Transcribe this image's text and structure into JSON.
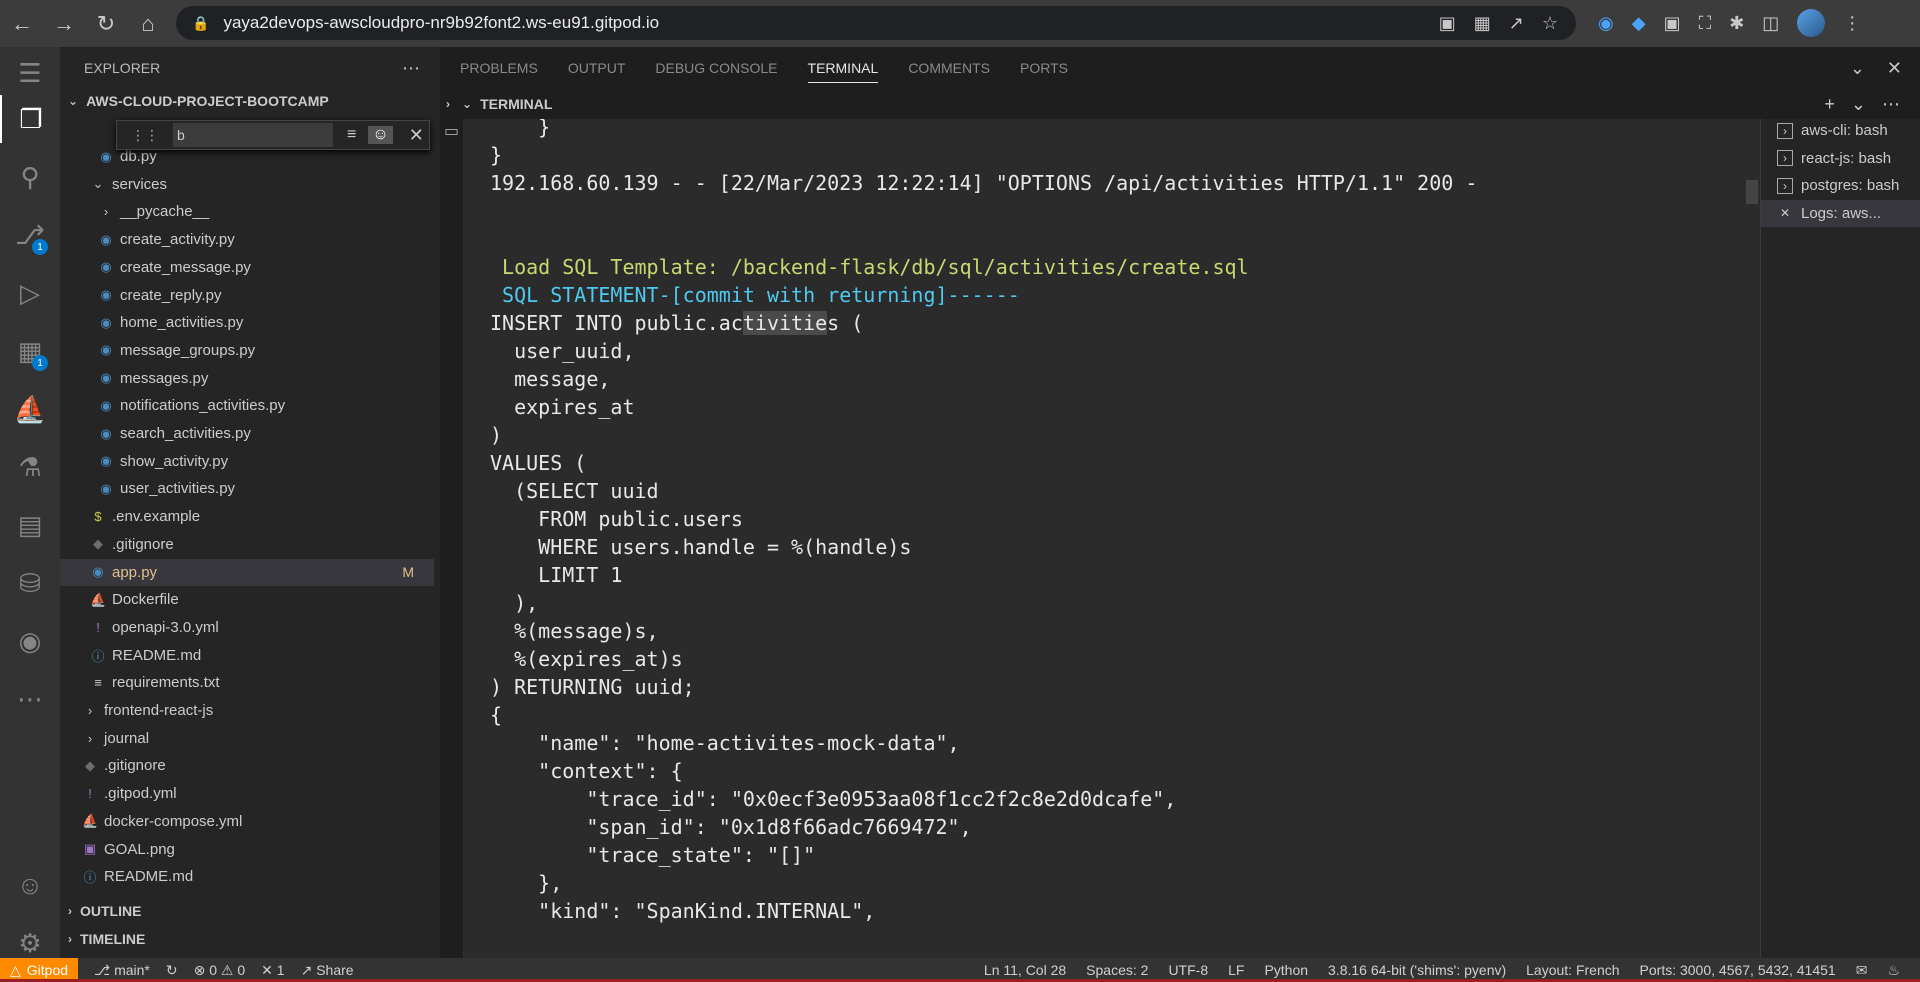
{
  "browser": {
    "url": "yaya2devops-awscloudpro-nr9b92font2.ws-eu91.gitpod.io"
  },
  "activity_bar": {
    "source_control_badge": "1",
    "extensions_badge": "1"
  },
  "sidebar": {
    "title": "EXPLORER",
    "project": "AWS-CLOUD-PROJECT-BOOTCAMP",
    "find_value": "b",
    "outline": "OUTLINE",
    "timeline": "TIMELINE",
    "tree": [
      {
        "label": "db.py",
        "icon": "python-icon",
        "indent": 2,
        "kind": "py"
      },
      {
        "label": "services",
        "icon": "chevron-down-icon",
        "indent": 1,
        "kind": "folder"
      },
      {
        "label": "__pycache__",
        "icon": "chevron-right-icon",
        "indent": 2,
        "kind": "folder"
      },
      {
        "label": "create_activity.py",
        "icon": "python-icon",
        "indent": 2,
        "kind": "py"
      },
      {
        "label": "create_message.py",
        "icon": "python-icon",
        "indent": 2,
        "kind": "py"
      },
      {
        "label": "create_reply.py",
        "icon": "python-icon",
        "indent": 2,
        "kind": "py"
      },
      {
        "label": "home_activities.py",
        "icon": "python-icon",
        "indent": 2,
        "kind": "py"
      },
      {
        "label": "message_groups.py",
        "icon": "python-icon",
        "indent": 2,
        "kind": "py"
      },
      {
        "label": "messages.py",
        "icon": "python-icon",
        "indent": 2,
        "kind": "py"
      },
      {
        "label": "notifications_activities.py",
        "icon": "python-icon",
        "indent": 2,
        "kind": "py"
      },
      {
        "label": "search_activities.py",
        "icon": "python-icon",
        "indent": 2,
        "kind": "py"
      },
      {
        "label": "show_activity.py",
        "icon": "python-icon",
        "indent": 2,
        "kind": "py"
      },
      {
        "label": "user_activities.py",
        "icon": "python-icon",
        "indent": 2,
        "kind": "py"
      },
      {
        "label": ".env.example",
        "icon": "dollar-icon",
        "indent": 1,
        "kind": "env"
      },
      {
        "label": ".gitignore",
        "icon": "git-icon",
        "indent": 1,
        "kind": "git"
      },
      {
        "label": "app.py",
        "icon": "python-icon",
        "indent": 1,
        "kind": "py",
        "selected": true,
        "modified": "M"
      },
      {
        "label": "Dockerfile",
        "icon": "docker-icon",
        "indent": 1,
        "kind": "docker"
      },
      {
        "label": "openapi-3.0.yml",
        "icon": "exclamation-icon",
        "indent": 1,
        "kind": "yml"
      },
      {
        "label": "README.md",
        "icon": "info-icon",
        "indent": 1,
        "kind": "md"
      },
      {
        "label": "requirements.txt",
        "icon": "lines-icon",
        "indent": 1,
        "kind": "txt"
      },
      {
        "label": "frontend-react-js",
        "icon": "chevron-right-icon",
        "indent": 0,
        "kind": "folder"
      },
      {
        "label": "journal",
        "icon": "chevron-right-icon",
        "indent": 0,
        "kind": "folder"
      },
      {
        "label": ".gitignore",
        "icon": "git-icon",
        "indent": 0,
        "kind": "git"
      },
      {
        "label": ".gitpod.yml",
        "icon": "exclamation-icon",
        "indent": 0,
        "kind": "yml"
      },
      {
        "label": "docker-compose.yml",
        "icon": "docker-icon",
        "indent": 0,
        "kind": "docker"
      },
      {
        "label": "GOAL.png",
        "icon": "image-icon",
        "indent": 0,
        "kind": "png"
      },
      {
        "label": "README.md",
        "icon": "info-icon",
        "indent": 0,
        "kind": "md"
      }
    ]
  },
  "panel": {
    "tabs": [
      "PROBLEMS",
      "OUTPUT",
      "DEBUG CONSOLE",
      "TERMINAL",
      "COMMENTS",
      "PORTS"
    ],
    "active_tab": "TERMINAL",
    "terminal_header": "TERMINAL"
  },
  "terminal": {
    "lines": [
      {
        "text": "    }",
        "style": ""
      },
      {
        "text": "}",
        "style": ""
      },
      {
        "text": "192.168.60.139 - - [22/Mar/2023 12:22:14] \"OPTIONS /api/activities HTTP/1.1\" 200 -",
        "style": ""
      },
      {
        "text": "",
        "style": ""
      },
      {
        "text": "",
        "style": ""
      },
      {
        "text": " Load SQL Template: /backend-flask/db/sql/activities/create.sql",
        "style": "green"
      },
      {
        "text": " SQL STATEMENT-[commit with returning]------",
        "style": "cyan"
      },
      {
        "text": "INSERT INTO public.activities (",
        "style": "hl"
      },
      {
        "text": "  user_uuid,",
        "style": ""
      },
      {
        "text": "  message,",
        "style": ""
      },
      {
        "text": "  expires_at",
        "style": ""
      },
      {
        "text": ")",
        "style": ""
      },
      {
        "text": "VALUES (",
        "style": ""
      },
      {
        "text": "  (SELECT uuid",
        "style": ""
      },
      {
        "text": "    FROM public.users",
        "style": ""
      },
      {
        "text": "    WHERE users.handle = %(handle)s",
        "style": ""
      },
      {
        "text": "    LIMIT 1",
        "style": ""
      },
      {
        "text": "  ),",
        "style": ""
      },
      {
        "text": "  %(message)s,",
        "style": ""
      },
      {
        "text": "  %(expires_at)s",
        "style": ""
      },
      {
        "text": ") RETURNING uuid;",
        "style": ""
      },
      {
        "text": "{",
        "style": ""
      },
      {
        "text": "    \"name\": \"home-activites-mock-data\",",
        "style": ""
      },
      {
        "text": "    \"context\": {",
        "style": ""
      },
      {
        "text": "        \"trace_id\": \"0x0ecf3e0953aa08f1cc2f2c8e2d0dcafe\",",
        "style": ""
      },
      {
        "text": "        \"span_id\": \"0x1d8f66adc7669472\",",
        "style": ""
      },
      {
        "text": "        \"trace_state\": \"[]\"",
        "style": ""
      },
      {
        "text": "    },",
        "style": ""
      },
      {
        "text": "    \"kind\": \"SpanKind.INTERNAL\",",
        "style": ""
      }
    ],
    "hl_prefix": "INSERT INTO public.ac",
    "hl_word": "tivitie",
    "hl_suffix": "s ("
  },
  "terminal_list": [
    {
      "label": "aws-cli: bash",
      "icon": "terminal-icon"
    },
    {
      "label": "react-js: bash",
      "icon": "terminal-icon"
    },
    {
      "label": "postgres: bash",
      "icon": "terminal-icon"
    },
    {
      "label": "Logs: aws...",
      "icon": "tools-icon",
      "active": true
    }
  ],
  "status": {
    "gitpod": "Gitpod",
    "branch": "main*",
    "errors": "0",
    "warnings": "0",
    "ports_count": "1",
    "share": "Share",
    "cursor": "Ln 11, Col 28",
    "spaces": "Spaces: 2",
    "encoding": "UTF-8",
    "eol": "LF",
    "language": "Python",
    "interpreter": "3.8.16 64-bit ('shims': pyenv)",
    "layout": "Layout: French",
    "ports": "Ports: 3000, 4567, 5432, 41451"
  }
}
